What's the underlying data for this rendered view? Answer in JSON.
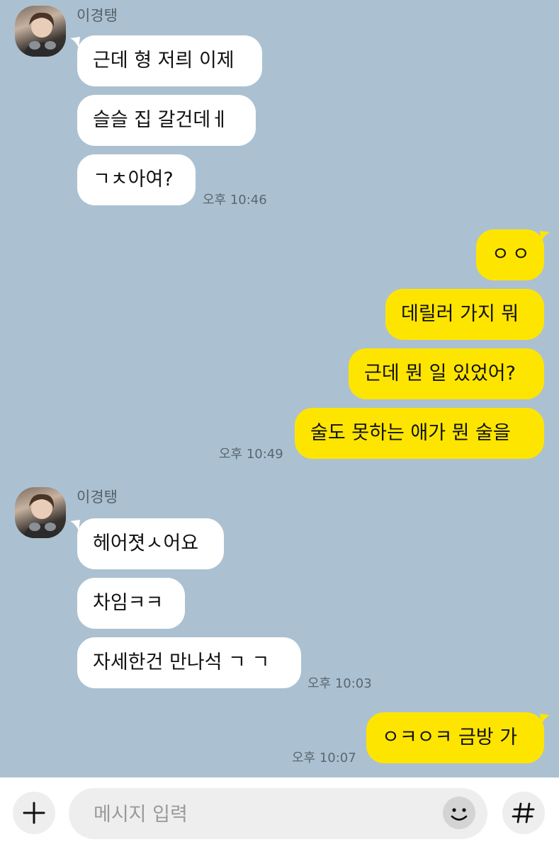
{
  "groups": [
    {
      "sender": "이경탱",
      "messages": [
        "근데 형 저릐 이제",
        "슬슬 집 갈건데ㅔ",
        "ㄱㅊ아여?"
      ],
      "time": "오후 10:46"
    },
    {
      "messages": [
        "ㅇㅇ",
        "데릴러 가지 뭐",
        "근데 뭔 일 있었어?",
        "술도 못하는 애가 뭔 술을"
      ],
      "time": "오후 10:49"
    },
    {
      "sender": "이경탱",
      "messages": [
        "헤어졋ㅅ어요",
        "차임ㅋㅋ",
        "자세한건 만나석 ㄱ ㄱ"
      ],
      "time": "오후 10:03"
    },
    {
      "messages": [
        "ㅇㅋㅇㅋ 금방 가"
      ],
      "time": "오후 10:07"
    }
  ],
  "input": {
    "placeholder": "메시지 입력"
  },
  "icons": {
    "add": "plus-icon",
    "emoji": "smiley-icon",
    "hash": "hash-icon"
  },
  "colors": {
    "background": "#abc1d1",
    "incoming": "#ffffff",
    "outgoing": "#fee500"
  }
}
